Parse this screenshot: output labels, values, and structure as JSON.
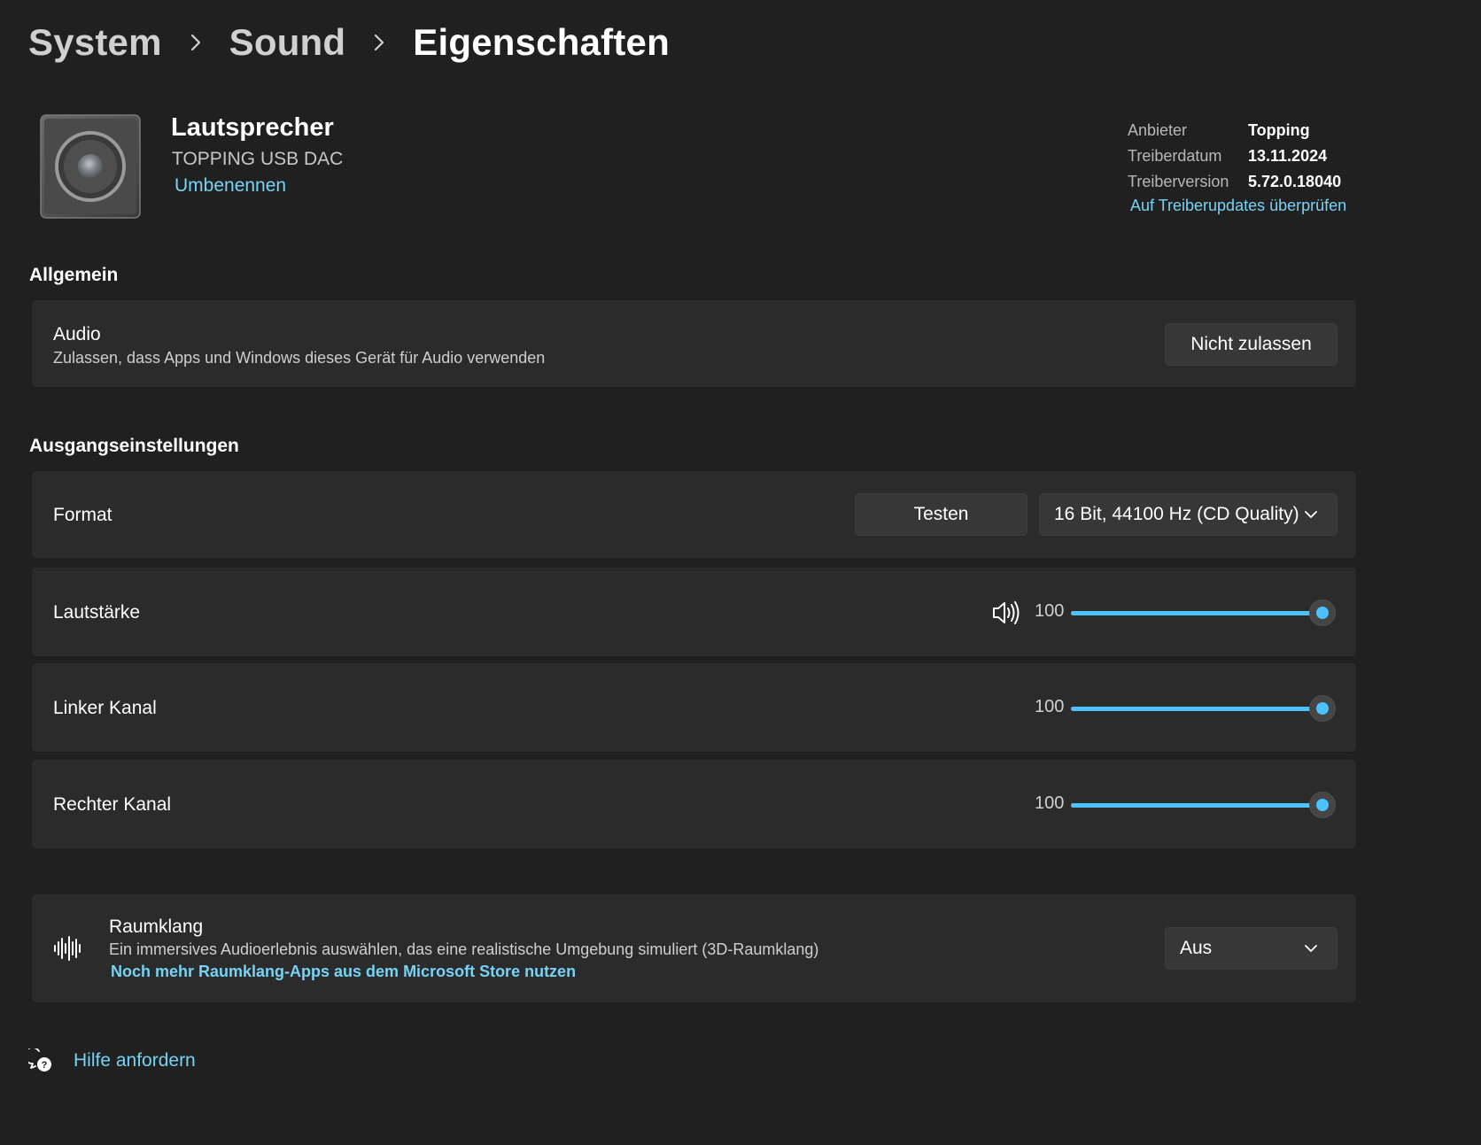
{
  "breadcrumb": {
    "items": [
      "System",
      "Sound",
      "Eigenschaften"
    ]
  },
  "device": {
    "name": "Lautsprecher",
    "model": "TOPPING USB DAC",
    "rename_label": "Umbenennen",
    "icon": "speaker-device-icon"
  },
  "driver": {
    "vendor_label": "Anbieter",
    "vendor_value": "Topping",
    "date_label": "Treiberdatum",
    "date_value": "13.11.2024",
    "version_label": "Treiberversion",
    "version_value": "5.72.0.18040",
    "update_link": "Auf Treiberupdates überprüfen"
  },
  "general": {
    "title": "Allgemein",
    "audio": {
      "title": "Audio",
      "description": "Zulassen, dass Apps und Windows dieses Gerät für Audio verwenden",
      "button": "Nicht zulassen"
    }
  },
  "output": {
    "title": "Ausgangseinstellungen",
    "format": {
      "label": "Format",
      "test_button": "Testen",
      "selected": "16 Bit, 44100 Hz (CD Quality)"
    },
    "volume": {
      "label": "Lautstärke",
      "value": "100",
      "level": 1.0,
      "icon": "speaker-volume-icon"
    },
    "left": {
      "label": "Linker Kanal",
      "value": "100",
      "level": 1.0
    },
    "right": {
      "label": "Rechter Kanal",
      "value": "100",
      "level": 1.0
    }
  },
  "spatial": {
    "title": "Raumklang",
    "description": "Ein immersives Audioerlebnis auswählen, das eine realistische Umgebung simuliert (3D-Raumklang)",
    "store_link": "Noch mehr Raumklang-Apps aus dem Microsoft Store nutzen",
    "selected": "Aus",
    "icon": "spatial-sound-icon"
  },
  "help": {
    "label": "Hilfe anfordern",
    "icon": "help-chat-icon"
  },
  "colors": {
    "background": "#202020",
    "card": "#2b2b2b",
    "accent": "#4cc2ff",
    "link": "#76d3f5"
  }
}
